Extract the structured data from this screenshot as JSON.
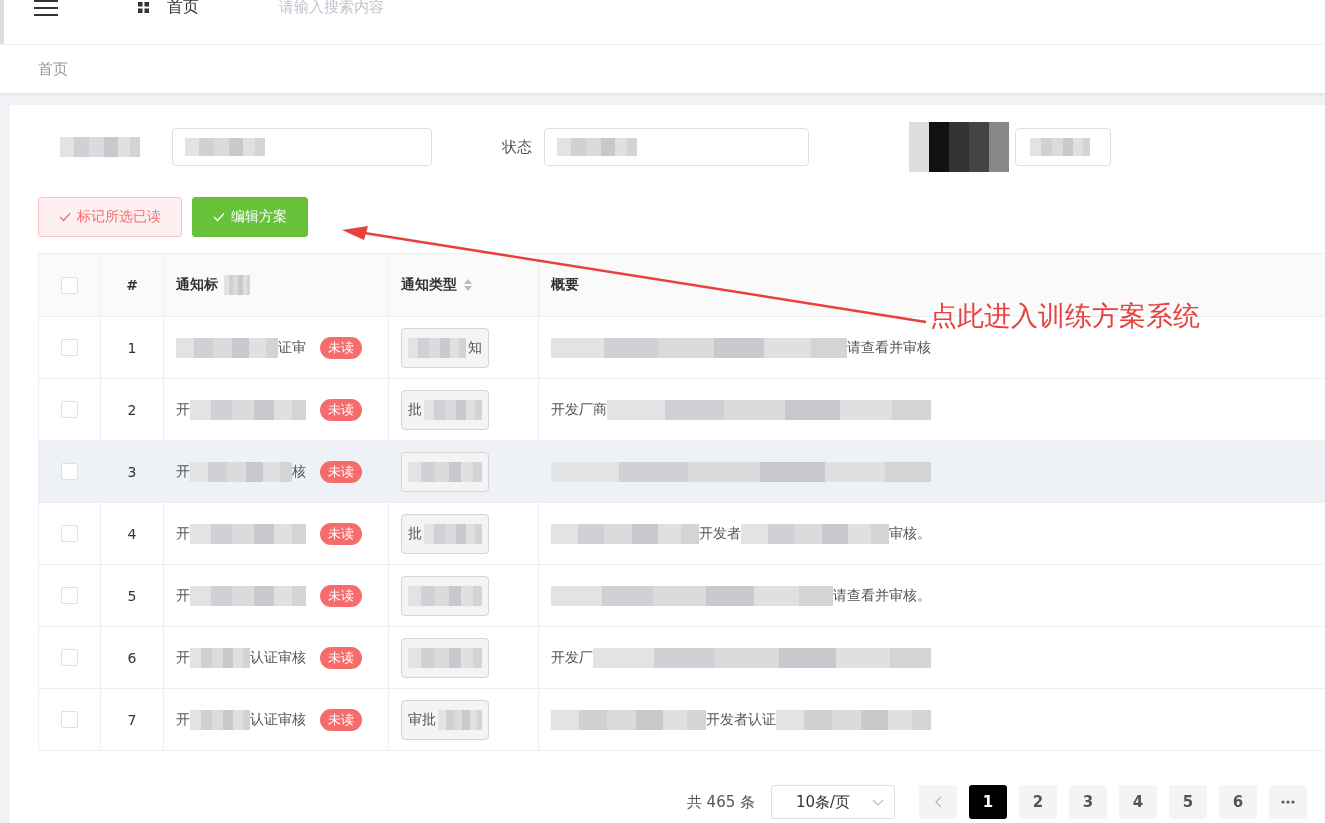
{
  "header": {
    "page_title": "首页",
    "search": {
      "placeholder": "请输入搜索内容"
    }
  },
  "breadcrumb": [
    "首页"
  ],
  "filters": {
    "status_label": "状态"
  },
  "actions": [
    {
      "label": "标记所选已读",
      "kind": "danger"
    },
    {
      "label": "编辑方案",
      "kind": "success"
    }
  ],
  "table": {
    "select_all_checked": false,
    "columns": [
      {
        "label": "#",
        "sortable": false
      },
      {
        "label": "通知标",
        "sortable": false
      },
      {
        "label": "通知类型",
        "sortable": true
      },
      {
        "label": "概要",
        "sortable": false
      }
    ],
    "rows": [
      {
        "checked": false,
        "highlighted": false,
        "index": "1",
        "title": [
          {
            "kind": "mosaic"
          },
          {
            "kind": "text",
            "text": "证审"
          }
        ],
        "unread": true,
        "status": "未读",
        "type": [
          {
            "kind": "mosaic"
          },
          {
            "kind": "text",
            "text": "知"
          }
        ],
        "summary": [
          {
            "kind": "mosaic"
          },
          {
            "kind": "text",
            "text": "请查看并审核"
          }
        ]
      },
      {
        "checked": false,
        "highlighted": false,
        "index": "2",
        "title": [
          {
            "kind": "text",
            "text": "开"
          },
          {
            "kind": "mosaic"
          }
        ],
        "unread": true,
        "status": "未读",
        "type": [
          {
            "kind": "text",
            "text": "批"
          },
          {
            "kind": "mosaic"
          }
        ],
        "summary": [
          {
            "kind": "text",
            "text": "开发厂商"
          },
          {
            "kind": "mosaic"
          }
        ]
      },
      {
        "checked": false,
        "highlighted": true,
        "index": "3",
        "title": [
          {
            "kind": "text",
            "text": "开"
          },
          {
            "kind": "mosaic"
          },
          {
            "kind": "text",
            "text": "核"
          }
        ],
        "unread": true,
        "status": "未读",
        "type": [
          {
            "kind": "mosaic"
          }
        ],
        "summary": [
          {
            "kind": "mosaic"
          }
        ]
      },
      {
        "checked": false,
        "highlighted": false,
        "index": "4",
        "title": [
          {
            "kind": "text",
            "text": "开"
          },
          {
            "kind": "mosaic"
          }
        ],
        "unread": true,
        "status": "未读",
        "type": [
          {
            "kind": "text",
            "text": "批"
          },
          {
            "kind": "mosaic"
          }
        ],
        "summary": [
          {
            "kind": "mosaic"
          },
          {
            "kind": "text",
            "text": "开发者"
          },
          {
            "kind": "mosaic"
          },
          {
            "kind": "text",
            "text": "审核。"
          }
        ]
      },
      {
        "checked": false,
        "highlighted": false,
        "index": "5",
        "title": [
          {
            "kind": "text",
            "text": "开"
          },
          {
            "kind": "mosaic"
          }
        ],
        "unread": true,
        "status": "未读",
        "type": [
          {
            "kind": "mosaic"
          }
        ],
        "summary": [
          {
            "kind": "mosaic"
          },
          {
            "kind": "text",
            "text": "请查看并审核。"
          }
        ]
      },
      {
        "checked": false,
        "highlighted": false,
        "index": "6",
        "title": [
          {
            "kind": "text",
            "text": "开"
          },
          {
            "kind": "mosaic"
          },
          {
            "kind": "text",
            "text": "认证审核"
          }
        ],
        "unread": true,
        "status": "未读",
        "type": [
          {
            "kind": "mosaic"
          }
        ],
        "summary": [
          {
            "kind": "text",
            "text": "开发厂"
          },
          {
            "kind": "mosaic"
          }
        ]
      },
      {
        "checked": false,
        "highlighted": false,
        "index": "7",
        "title": [
          {
            "kind": "text",
            "text": "开"
          },
          {
            "kind": "mosaic"
          },
          {
            "kind": "text",
            "text": "认证审核"
          }
        ],
        "unread": true,
        "status": "未读",
        "type": [
          {
            "kind": "text",
            "text": "审批"
          },
          {
            "kind": "mosaic"
          }
        ],
        "summary": [
          {
            "kind": "mosaic"
          },
          {
            "kind": "text",
            "text": "开发者认证"
          },
          {
            "kind": "mosaic"
          }
        ]
      }
    ]
  },
  "pagination": {
    "total": "共 465 条",
    "page_size": "10条/页",
    "pages": [
      {
        "label": "1",
        "selected": true
      },
      {
        "label": "2",
        "selected": false
      },
      {
        "label": "3",
        "selected": false
      },
      {
        "label": "4",
        "selected": false
      },
      {
        "label": "5",
        "selected": false
      },
      {
        "label": "6",
        "selected": false
      }
    ]
  },
  "annotation": {
    "text": "点此进入训练方案系统"
  }
}
